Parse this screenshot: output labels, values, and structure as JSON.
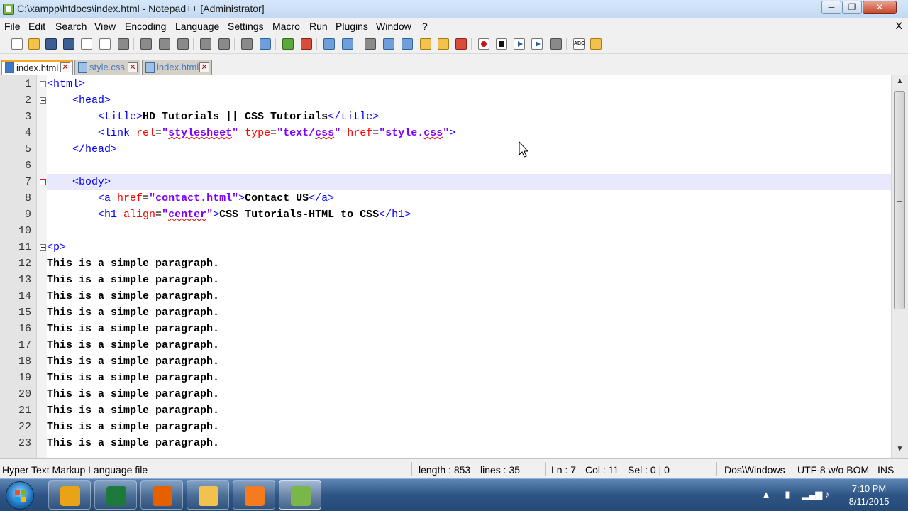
{
  "window": {
    "title": "C:\\xampp\\htdocs\\index.html - Notepad++ [Administrator]",
    "min_glyph": "─",
    "max_glyph": "❐",
    "close_glyph": "✕"
  },
  "menu": {
    "items": [
      "File",
      "Edit",
      "Search",
      "View",
      "Encoding",
      "Language",
      "Settings",
      "Macro",
      "Run",
      "Plugins",
      "Window",
      "?"
    ],
    "close_doc": "X"
  },
  "tabs": [
    {
      "label": "index.html",
      "active": true
    },
    {
      "label": "style.css",
      "active": false
    },
    {
      "label": "index.html",
      "active": false
    }
  ],
  "editor": {
    "line_numbers": [
      "1",
      "2",
      "3",
      "4",
      "5",
      "6",
      "7",
      "8",
      "9",
      "10",
      "11",
      "12",
      "13",
      "14",
      "15",
      "16",
      "17",
      "18",
      "19",
      "20",
      "21",
      "22",
      "23"
    ],
    "current_line": 7,
    "lines": [
      [
        {
          "t": "tg",
          "v": "<html>"
        }
      ],
      [
        {
          "t": "ind",
          "v": "    "
        },
        {
          "t": "tg",
          "v": "<head>"
        }
      ],
      [
        {
          "t": "ind",
          "v": "        "
        },
        {
          "t": "tg",
          "v": "<title>"
        },
        {
          "t": "tx",
          "v": "HD Tutorials || CSS Tutorials"
        },
        {
          "t": "tg",
          "v": "</title>"
        }
      ],
      [
        {
          "t": "ind",
          "v": "        "
        },
        {
          "t": "tg",
          "v": "<link "
        },
        {
          "t": "at",
          "v": "rel"
        },
        {
          "t": "eq",
          "v": "="
        },
        {
          "t": "st",
          "v": "\""
        },
        {
          "t": "st spell",
          "v": "stylesheet"
        },
        {
          "t": "st",
          "v": "\""
        },
        {
          "t": "tg",
          "v": " "
        },
        {
          "t": "at",
          "v": "type"
        },
        {
          "t": "eq",
          "v": "="
        },
        {
          "t": "st",
          "v": "\"text/"
        },
        {
          "t": "st spell",
          "v": "css"
        },
        {
          "t": "st",
          "v": "\""
        },
        {
          "t": "tg",
          "v": " "
        },
        {
          "t": "at",
          "v": "href"
        },
        {
          "t": "eq",
          "v": "="
        },
        {
          "t": "st",
          "v": "\"style."
        },
        {
          "t": "st spell",
          "v": "css"
        },
        {
          "t": "st",
          "v": "\""
        },
        {
          "t": "tg",
          "v": ">"
        }
      ],
      [
        {
          "t": "ind",
          "v": "    "
        },
        {
          "t": "tg",
          "v": "</head>"
        }
      ],
      [
        {
          "t": "ind",
          "v": ""
        }
      ],
      [
        {
          "t": "ind",
          "v": "    "
        },
        {
          "t": "tg",
          "v": "<body>"
        }
      ],
      [
        {
          "t": "ind",
          "v": "        "
        },
        {
          "t": "tg",
          "v": "<a "
        },
        {
          "t": "at",
          "v": "href"
        },
        {
          "t": "eq",
          "v": "="
        },
        {
          "t": "st",
          "v": "\"contact.html\""
        },
        {
          "t": "tg",
          "v": ">"
        },
        {
          "t": "tx",
          "v": "Contact US"
        },
        {
          "t": "tg",
          "v": "</a>"
        }
      ],
      [
        {
          "t": "ind",
          "v": "        "
        },
        {
          "t": "tg",
          "v": "<h1 "
        },
        {
          "t": "at",
          "v": "align"
        },
        {
          "t": "eq",
          "v": "="
        },
        {
          "t": "st",
          "v": "\""
        },
        {
          "t": "st spell",
          "v": "center"
        },
        {
          "t": "st",
          "v": "\""
        },
        {
          "t": "tg",
          "v": ">"
        },
        {
          "t": "tx",
          "v": "CSS Tutorials-HTML to CSS"
        },
        {
          "t": "tg",
          "v": "</h1>"
        }
      ],
      [
        {
          "t": "ind",
          "v": ""
        }
      ],
      [
        {
          "t": "tg",
          "v": "<p>"
        }
      ],
      [
        {
          "t": "tx",
          "v": "This is a simple paragraph."
        }
      ],
      [
        {
          "t": "tx",
          "v": "This is a simple paragraph."
        }
      ],
      [
        {
          "t": "tx",
          "v": "This is a simple paragraph."
        }
      ],
      [
        {
          "t": "tx",
          "v": "This is a simple paragraph."
        }
      ],
      [
        {
          "t": "tx",
          "v": "This is a simple paragraph."
        }
      ],
      [
        {
          "t": "tx",
          "v": "This is a simple paragraph."
        }
      ],
      [
        {
          "t": "tx",
          "v": "This is a simple paragraph."
        }
      ],
      [
        {
          "t": "tx",
          "v": "This is a simple paragraph."
        }
      ],
      [
        {
          "t": "tx",
          "v": "This is a simple paragraph."
        }
      ],
      [
        {
          "t": "tx",
          "v": "This is a simple paragraph."
        }
      ],
      [
        {
          "t": "tx",
          "v": "This is a simple paragraph."
        }
      ],
      [
        {
          "t": "tx",
          "v": "This is a simple paragraph."
        }
      ]
    ]
  },
  "status": {
    "file_type": "Hyper Text Markup Language file",
    "length": "length : 853",
    "lines": "lines : 35",
    "ln": "Ln : 7",
    "col": "Col : 11",
    "sel": "Sel : 0 | 0",
    "eol": "Dos\\Windows",
    "encoding": "UTF-8 w/o BOM",
    "mode": "INS"
  },
  "taskbar": {
    "apps": [
      {
        "name": "chrome",
        "color": "#e8a317"
      },
      {
        "name": "excel",
        "color": "#1e7a3c"
      },
      {
        "name": "firefox",
        "color": "#e66000"
      },
      {
        "name": "explorer",
        "color": "#f2c14e"
      },
      {
        "name": "xampp",
        "color": "#f47b20"
      },
      {
        "name": "notepad-plus-plus",
        "color": "#7bb64a"
      }
    ],
    "time": "7:10 PM",
    "date": "8/11/2015"
  }
}
